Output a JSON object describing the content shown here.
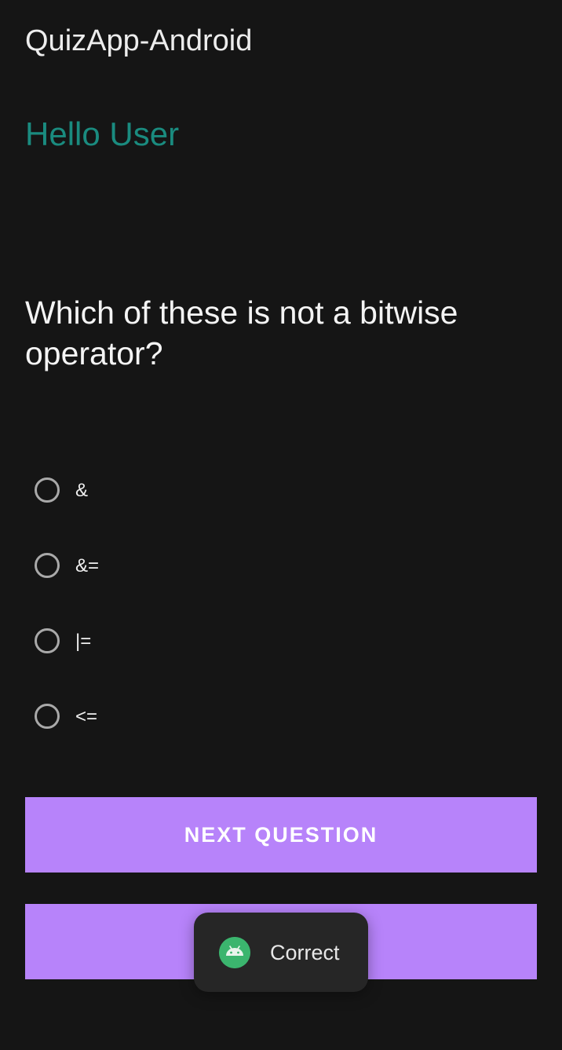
{
  "app": {
    "title": "QuizApp-Android"
  },
  "main": {
    "greeting": "Hello User",
    "question": "Which of these is not a bitwise operator?",
    "options": [
      {
        "label": "&",
        "selected": false
      },
      {
        "label": "&=",
        "selected": false
      },
      {
        "label": "|=",
        "selected": false
      },
      {
        "label": "<=",
        "selected": false
      }
    ],
    "next_button_label": "NEXT QUESTION",
    "second_button_label": ""
  },
  "toast": {
    "icon": "android-icon",
    "message": "Correct"
  },
  "colors": {
    "background": "#151515",
    "accent_teal": "#1a8b7f",
    "button_purple": "#b783fa",
    "toast_bg": "#262626",
    "android_green": "#3bb56e"
  }
}
